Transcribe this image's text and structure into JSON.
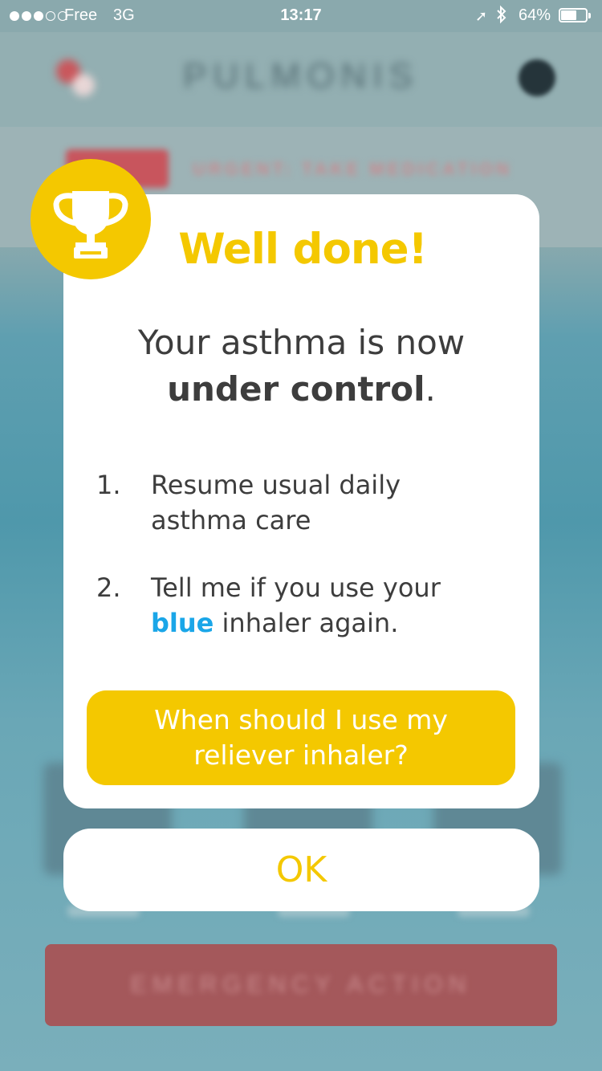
{
  "status_bar": {
    "carrier": "Free",
    "network": "3G",
    "time": "13:17",
    "battery_percent": "64%",
    "battery_level": 0.64,
    "signal_bars_filled": 3,
    "signal_bars_total": 5,
    "location_icon": "location-arrow-icon",
    "bluetooth_icon": "bluetooth-icon"
  },
  "background": {
    "app_title": "PULMONIS",
    "urgent_label": "URGENT: TAKE MEDICATION",
    "emergency_button": "EMERGENCY ACTION"
  },
  "modal": {
    "title": "Well done!",
    "headline_prefix": "Your asthma is now",
    "headline_bold": "under control",
    "headline_suffix": ".",
    "steps": [
      {
        "number": "1.",
        "text": "Resume usual daily asthma care"
      },
      {
        "number": "2.",
        "text_prefix": "Tell me if you use your",
        "highlight": "blue",
        "text_suffix": "inhaler again."
      }
    ],
    "reliever_button": "When should I use my reliever inhaler?",
    "ok_button": "OK"
  },
  "colors": {
    "accent_yellow": "#f4c800",
    "highlight_blue": "#1aa6e8",
    "text_dark": "#3d3d3d"
  }
}
